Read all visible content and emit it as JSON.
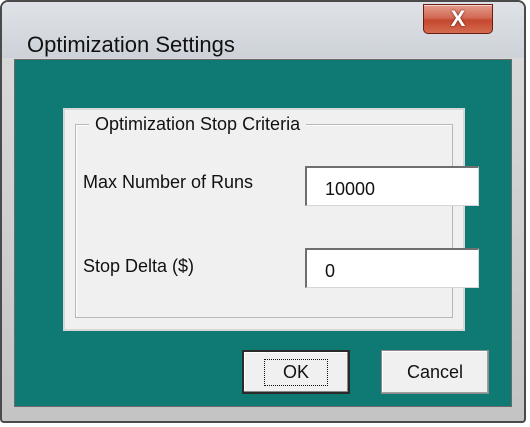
{
  "window": {
    "title": "Optimization Settings",
    "close_icon": "close-icon",
    "close_glyph": "X"
  },
  "group": {
    "legend": "Optimization Stop Criteria",
    "fields": [
      {
        "label": "Max Number of Runs",
        "value": "10000"
      },
      {
        "label": "Stop Delta ($)",
        "value": "0"
      }
    ]
  },
  "buttons": {
    "ok_label": "OK",
    "cancel_label": "Cancel"
  },
  "colors": {
    "client_background": "#0e7a73",
    "close_button": "#c4482f"
  }
}
